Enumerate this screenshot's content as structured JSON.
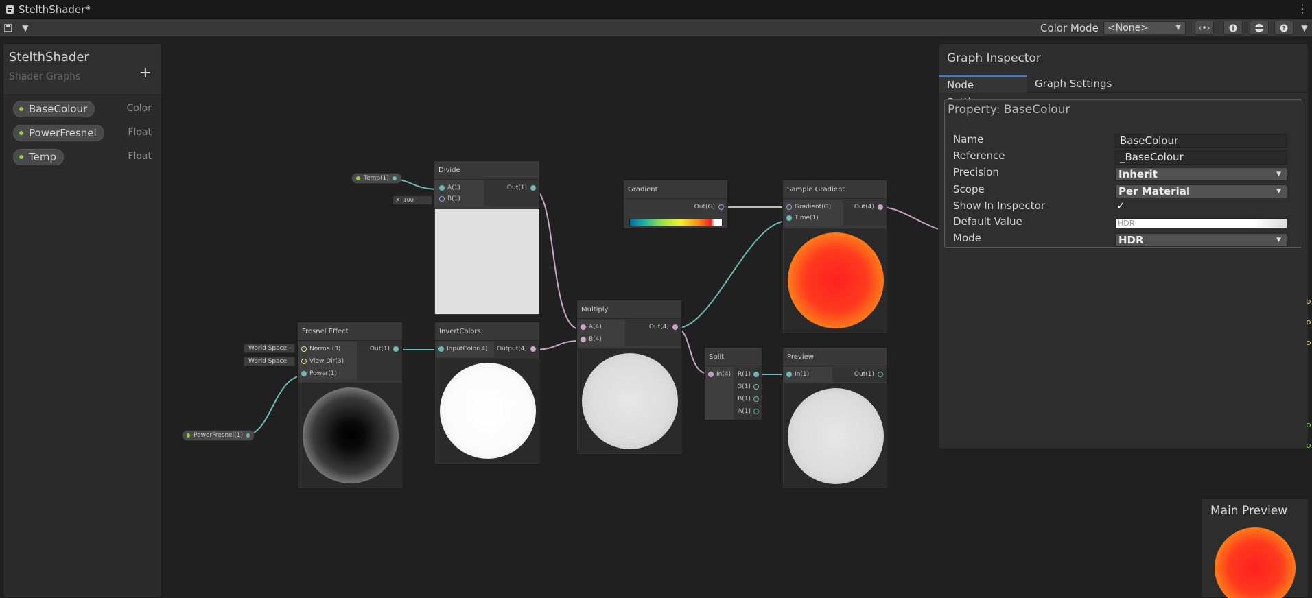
{
  "window": {
    "tab_title": "StelthShader*"
  },
  "toolbar": {
    "color_mode_label": "Color Mode",
    "color_mode_value": "<None>"
  },
  "blackboard": {
    "title": "StelthShader",
    "subtitle": "Shader Graphs",
    "properties": [
      {
        "name": "BaseColour",
        "type": "Color"
      },
      {
        "name": "PowerFresnel",
        "type": "Float"
      },
      {
        "name": "Temp",
        "type": "Float"
      }
    ]
  },
  "nodes": {
    "divide": {
      "title": "Divide",
      "in_a": "A(1)",
      "in_b": "B(1)",
      "out": "Out(1)",
      "b_axis": "X",
      "b_value": "100"
    },
    "temp_chip": "Temp(1)",
    "gradient": {
      "title": "Gradient",
      "out": "Out(G)"
    },
    "sample_gradient": {
      "title": "Sample Gradient",
      "in_grad": "Gradient(G)",
      "in_time": "Time(1)",
      "out": "Out(4)"
    },
    "fresnel": {
      "title": "Fresnel Effect",
      "in_normal": "Normal(3)",
      "in_view": "View Dir(3)",
      "in_power": "Power(1)",
      "out": "Out(1)",
      "space1": "World Space",
      "space2": "World Space"
    },
    "powerfresnel_chip": "PowerFresnel(1)",
    "invert": {
      "title": "InvertColors",
      "in": "InputColor(4)",
      "out": "Output(4)"
    },
    "multiply": {
      "title": "Multiply",
      "in_a": "A(4)",
      "in_b": "B(4)",
      "out": "Out(4)"
    },
    "split": {
      "title": "Split",
      "in": "In(4)",
      "out_r": "R(1)",
      "out_g": "G(1)",
      "out_b": "B(1)",
      "out_a": "A(1)"
    },
    "preview": {
      "title": "Preview",
      "in": "In(1)",
      "out": "Out(1)"
    }
  },
  "inspector": {
    "title": "Graph Inspector",
    "tabs": [
      "Node Settings",
      "Graph Settings"
    ],
    "section_title": "Property: BaseColour",
    "rows": {
      "name_label": "Name",
      "name_value": "BaseColour",
      "reference_label": "Reference",
      "reference_value": "_BaseColour",
      "precision_label": "Precision",
      "precision_value": "Inherit",
      "scope_label": "Scope",
      "scope_value": "Per Material",
      "show_label": "Show In Inspector",
      "show_value": "✓",
      "default_label": "Default Value",
      "default_value": "HDR",
      "mode_label": "Mode",
      "mode_value": "HDR"
    }
  },
  "main_preview": {
    "title": "Main Preview"
  },
  "colors": {
    "accent": "#3f7bd8",
    "wire_teal": "#6fb8b8",
    "wire_pink": "#c9a6c6",
    "property_dot": "#8fd24a"
  }
}
